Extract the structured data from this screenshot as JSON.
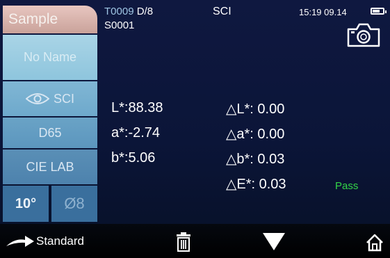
{
  "sidebar": {
    "sample_label": "Sample",
    "name_label": "No Name",
    "mode_label": "SCI",
    "illuminant_label": "D65",
    "colorspace_label": "CIE LAB",
    "observer_label": "10°",
    "aperture_label": "Ø8"
  },
  "header": {
    "standard_id": "T0009",
    "geometry": "D/8",
    "sample_id": "S0001",
    "mode": "SCI",
    "time": "15:19",
    "date": "09.14",
    "battery_level": 0.7
  },
  "measurements": {
    "L": "L*:88.38",
    "a": "a*:-2.74",
    "b": "b*:5.06",
    "dL": "△L*: 0.00",
    "da": "△a*: 0.00",
    "db": "△b*: 0.03",
    "dE": "△E*: 0.03",
    "result": "Pass"
  },
  "bottom_bar": {
    "standard_label": "Standard"
  },
  "colors": {
    "pass": "#33d447",
    "sample_tab": "#c9a29a"
  }
}
